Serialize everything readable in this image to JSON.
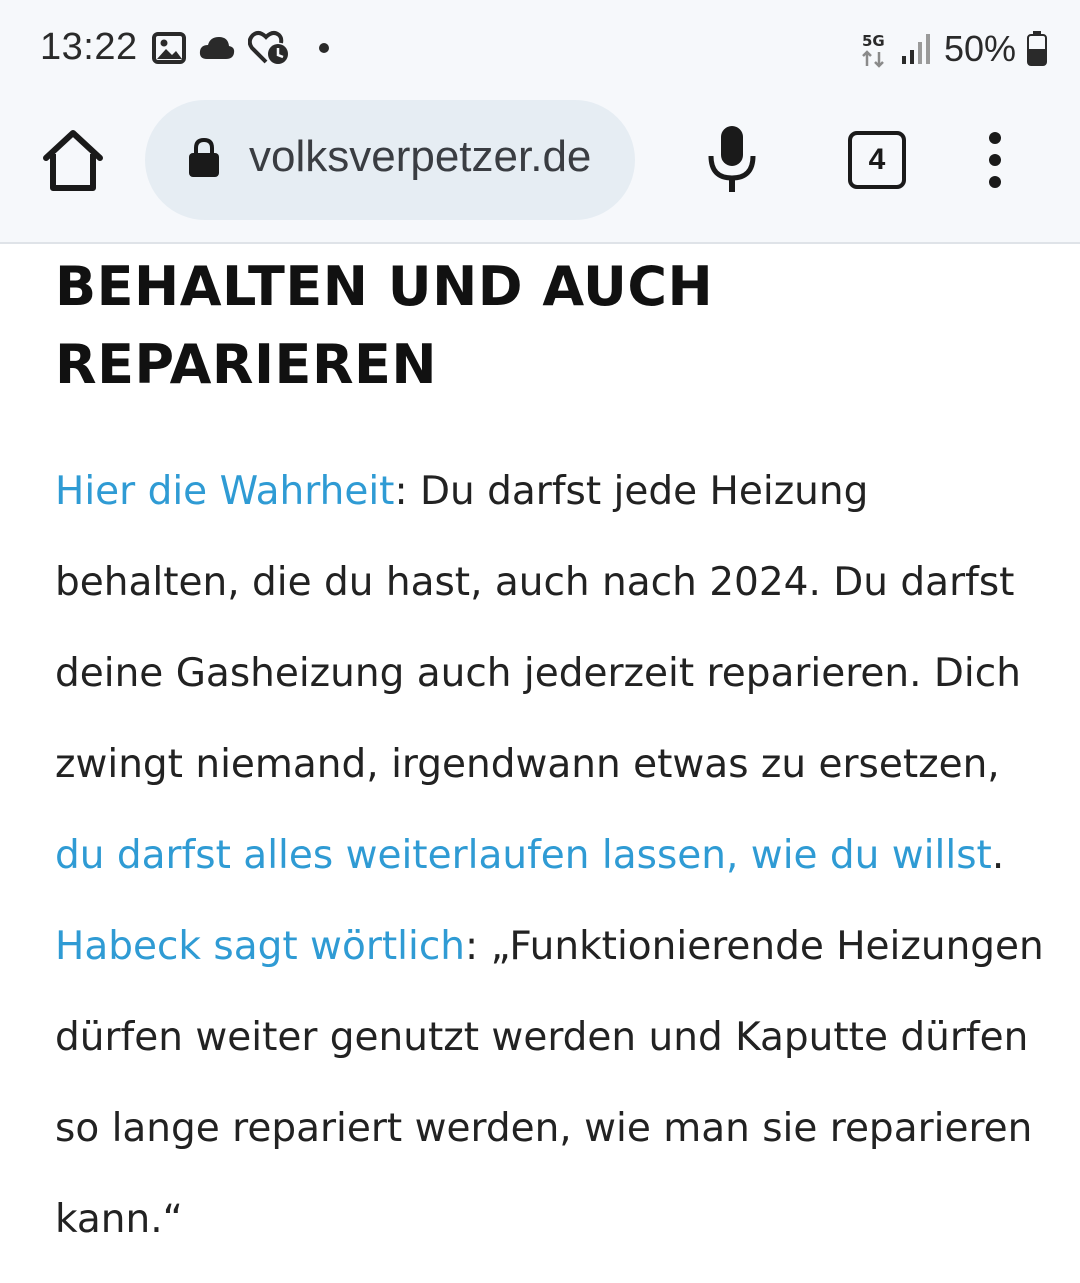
{
  "status_bar": {
    "time": "13:22",
    "notification_icons": [
      "gallery-icon",
      "cloud-icon",
      "heart-clock-icon",
      "more-dot-icon"
    ],
    "network": "5G",
    "battery_text": "50%"
  },
  "browser": {
    "url": "volksverpetzer.de",
    "tab_count": "4"
  },
  "article": {
    "heading": "BEHALTEN UND AUCH REPARIEREN",
    "link1": "Hier die Wahrheit",
    "text1": ": Du darfst jede Heizung behalten, die du hast, auch nach 2024. Du darfst deine Gasheizung auch jederzeit reparieren. Dich zwingt niemand, irgendwann etwas zu ersetzen, ",
    "link2": "du darfst alles weiterlaufen lassen, wie du willst",
    "text2": ". ",
    "link3": "Habeck sagt wörtlich",
    "text3": ": „Funktionierende Heizungen dürfen weiter genutzt werden und Kaputte dürfen so lange repariert werden, wie man sie reparieren kann.“"
  },
  "colors": {
    "link": "#2f9bd4",
    "chrome_bg": "#f6f8fb",
    "urlbar_bg": "#e6edf3"
  }
}
